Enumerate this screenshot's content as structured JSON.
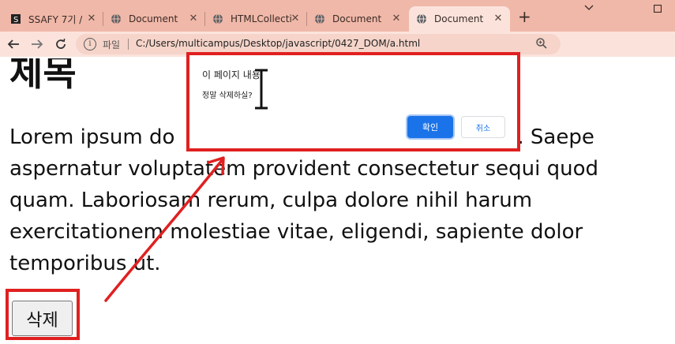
{
  "browser": {
    "tabs": [
      {
        "title": "SSAFY 7기 / ",
        "favicon": "ssafy-logo-icon",
        "active": false
      },
      {
        "title": "Document",
        "favicon": "globe-icon",
        "active": false
      },
      {
        "title": "HTMLCollecti",
        "favicon": "globe-icon",
        "active": false
      },
      {
        "title": "Document",
        "favicon": "globe-icon",
        "active": false
      },
      {
        "title": "Document",
        "favicon": "globe-icon",
        "active": true
      }
    ],
    "new_tab": "+",
    "address": {
      "scheme_label": "파일",
      "url": "C:/Users/multicampus/Desktop/javascript/0427_DOM/a.html"
    }
  },
  "page": {
    "heading": "제목",
    "paragraph": "Lorem ipsum do                                        cing elit. Saepe\naspernatur voluptatem provident consectetur sequi quod\nquam. Laboriosam rerum, culpa dolore nihil harum\nexercitationem molestiae vitae, eligendi, sapiente dolor\ntemporibus ut.",
    "delete_button": "삭제"
  },
  "dialog": {
    "title": "이 페이지 내용:",
    "message": "정말 삭제하실?",
    "ok": "확인",
    "cancel": "취소"
  },
  "colors": {
    "tab_strip": "#f0b8a8",
    "toolbar": "#fbe3dc",
    "annotation_red": "#e02020",
    "ok_button": "#1a73e8"
  }
}
